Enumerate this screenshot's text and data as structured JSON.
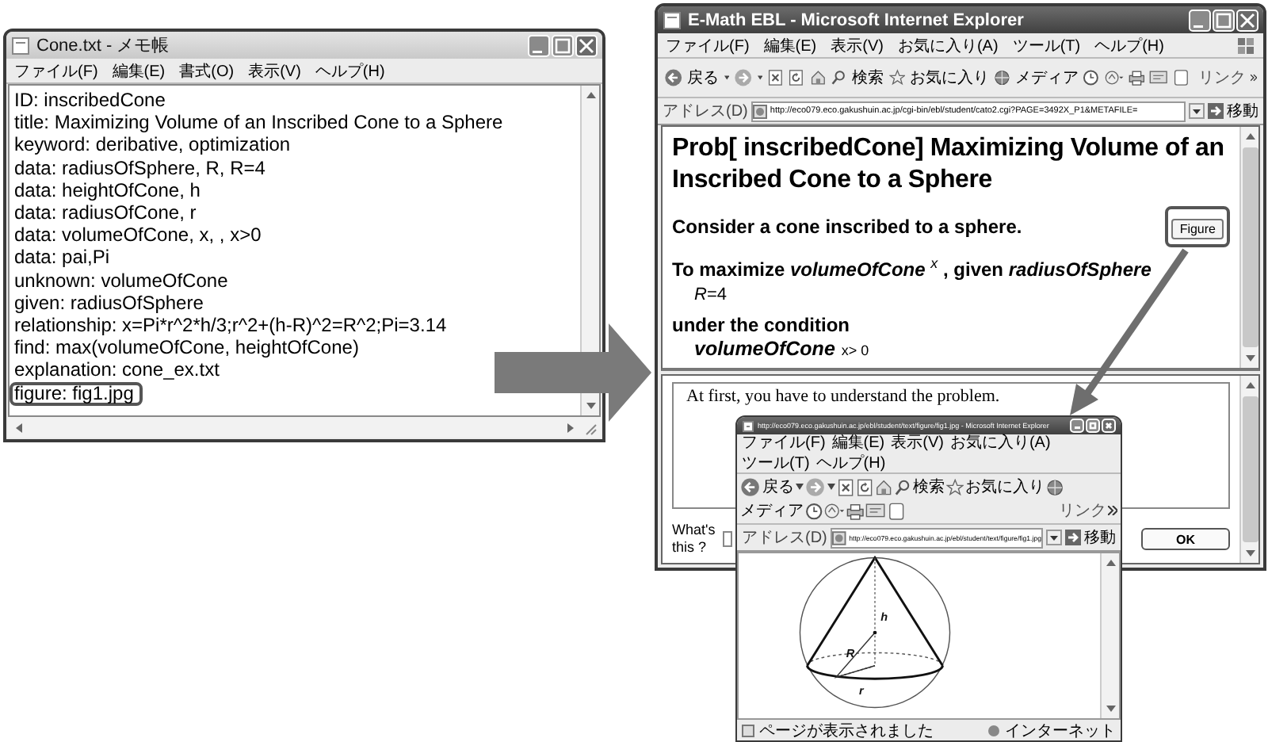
{
  "notepad": {
    "title": "Cone.txt - メモ帳",
    "menu": [
      "ファイル(F)",
      "編集(E)",
      "書式(O)",
      "表示(V)",
      "ヘルプ(H)"
    ],
    "lines": [
      {
        "text": "ID: inscribedCone",
        "highlighted": false
      },
      {
        "text": "title: Maximizing Volume of an Inscribed Cone to a Sphere",
        "highlighted": false
      },
      {
        "text": "keyword: deribative, optimization",
        "highlighted": false
      },
      {
        "text": "data: radiusOfSphere, R, R=4",
        "highlighted": false
      },
      {
        "text": "data: heightOfCone, h",
        "highlighted": false
      },
      {
        "text": "data: radiusOfCone, r",
        "highlighted": false
      },
      {
        "text": "data: volumeOfCone, x, , x>0",
        "highlighted": false
      },
      {
        "text": "data: pai,Pi",
        "highlighted": false
      },
      {
        "text": "unknown: volumeOfCone",
        "highlighted": false
      },
      {
        "text": "given: radiusOfSphere",
        "highlighted": false
      },
      {
        "text": "relationship: x=Pi*r^2*h/3;r^2+(h-R)^2=R^2;Pi=3.14",
        "highlighted": false
      },
      {
        "text": "find: max(volumeOfCone, heightOfCone)",
        "highlighted": false
      },
      {
        "text": "explanation: cone_ex.txt",
        "highlighted": false
      },
      {
        "text": "figure: fig1.jpg",
        "highlighted": true
      }
    ]
  },
  "browser": {
    "title": "E-Math EBL - Microsoft Internet Explorer",
    "active": true,
    "menu": [
      "ファイル(F)",
      "編集(E)",
      "表示(V)",
      "お気に入り(A)",
      "ツール(T)",
      "ヘルプ(H)"
    ],
    "toolbar": {
      "back": "戻る",
      "search": "検索",
      "favorites": "お気に入り",
      "media": "メディア",
      "links": "リンク"
    },
    "address": {
      "label": "アドレス(D)",
      "url": "http://eco079.eco.gakushuin.ac.jp/cgi-bin/ebl/student/cato2.cgi?PAGE=3492X_P1&METAFILE=",
      "go": "移動"
    },
    "heading": "Prob[ inscribedCone] Maximizing Volume of an Inscribed Cone to a Sphere",
    "intro": "Consider a cone inscribed to a sphere.",
    "figure_button": {
      "label": "Figure",
      "highlighted": true
    },
    "goal": "To maximize *volumeOfCone* $^{x}$ , given *radiusOfSphere*",
    "given_value": "*R*=4",
    "condition_label": "under the condition",
    "condition": {
      "term": "volumeOfCone",
      "expression": "x> 0"
    },
    "explanation": "At first, you have to understand the problem.",
    "help_label": "What's this ?",
    "ok_button": "OK"
  },
  "figure_window": {
    "title": "http://eco079.eco.gakushuin.ac.jp/ebl/student/text/figure/fig1.jpg - Microsoft Internet Explorer",
    "active": true,
    "menu": [
      "ファイル(F)",
      "編集(E)",
      "表示(V)",
      "お気に入り(A)",
      "ツール(T)",
      "ヘルプ(H)"
    ],
    "toolbar": {
      "back": "戻る",
      "search": "検索",
      "favorites": "お気に入り",
      "media": "メディア",
      "links": "リンク"
    },
    "address": {
      "label": "アドレス(D)",
      "url": "http://eco079.eco.gakushuin.ac.jp/ebl/student/text/figure/fig1.jpg",
      "go": "移動"
    },
    "figure_labels": {
      "height": "h",
      "sphere_radius": "R",
      "cone_radius": "r"
    },
    "status": "ページが表示されました",
    "zone": "インターネット"
  }
}
